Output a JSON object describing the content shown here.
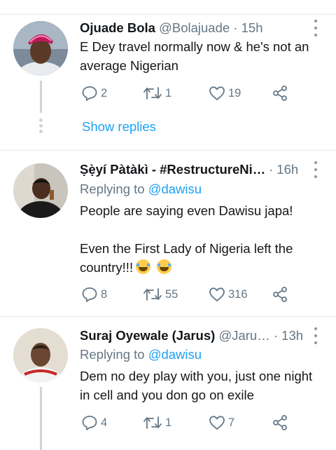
{
  "tweets": [
    {
      "display_name": "Ojuade  Bola",
      "handle": "@Bolajuade",
      "time": "· 15h",
      "reply_prefix": "",
      "reply_handle": "",
      "text_lines": [
        "E Dey travel normally now & he's not an",
        "average Nigerian"
      ],
      "counts": {
        "reply": "2",
        "retweet": "1",
        "like": "19"
      },
      "show_replies": "Show replies"
    },
    {
      "display_name": "Ṣẹ̀yí Pàtàkì - #RestructureNi…",
      "handle": "",
      "time": "· 16h",
      "reply_prefix": "Replying to ",
      "reply_handle": "@dawisu",
      "text_lines": [
        "People are saying even Dawisu japa!",
        "",
        "Even the First Lady of Nigeria left the",
        "country!!!"
      ],
      "counts": {
        "reply": "8",
        "retweet": "55",
        "like": "316"
      }
    },
    {
      "display_name": "Suraj Oyewale (Jarus)",
      "handle": "@Jaru…",
      "time": "· 13h",
      "reply_prefix": "Replying to ",
      "reply_handle": "@dawisu",
      "text_lines": [
        "Dem no dey play with you, just one night",
        "in cell and you don go on exile"
      ],
      "counts": {
        "reply": "4",
        "retweet": "1",
        "like": "7"
      }
    }
  ],
  "icons": [
    "reply-icon",
    "retweet-icon",
    "like-icon",
    "share-icon",
    "more-icon"
  ],
  "colors": {
    "link": "#1da1f2",
    "secondary": "#657786",
    "divider": "#e1e8ed",
    "thread_line": "#ccd6dd"
  }
}
